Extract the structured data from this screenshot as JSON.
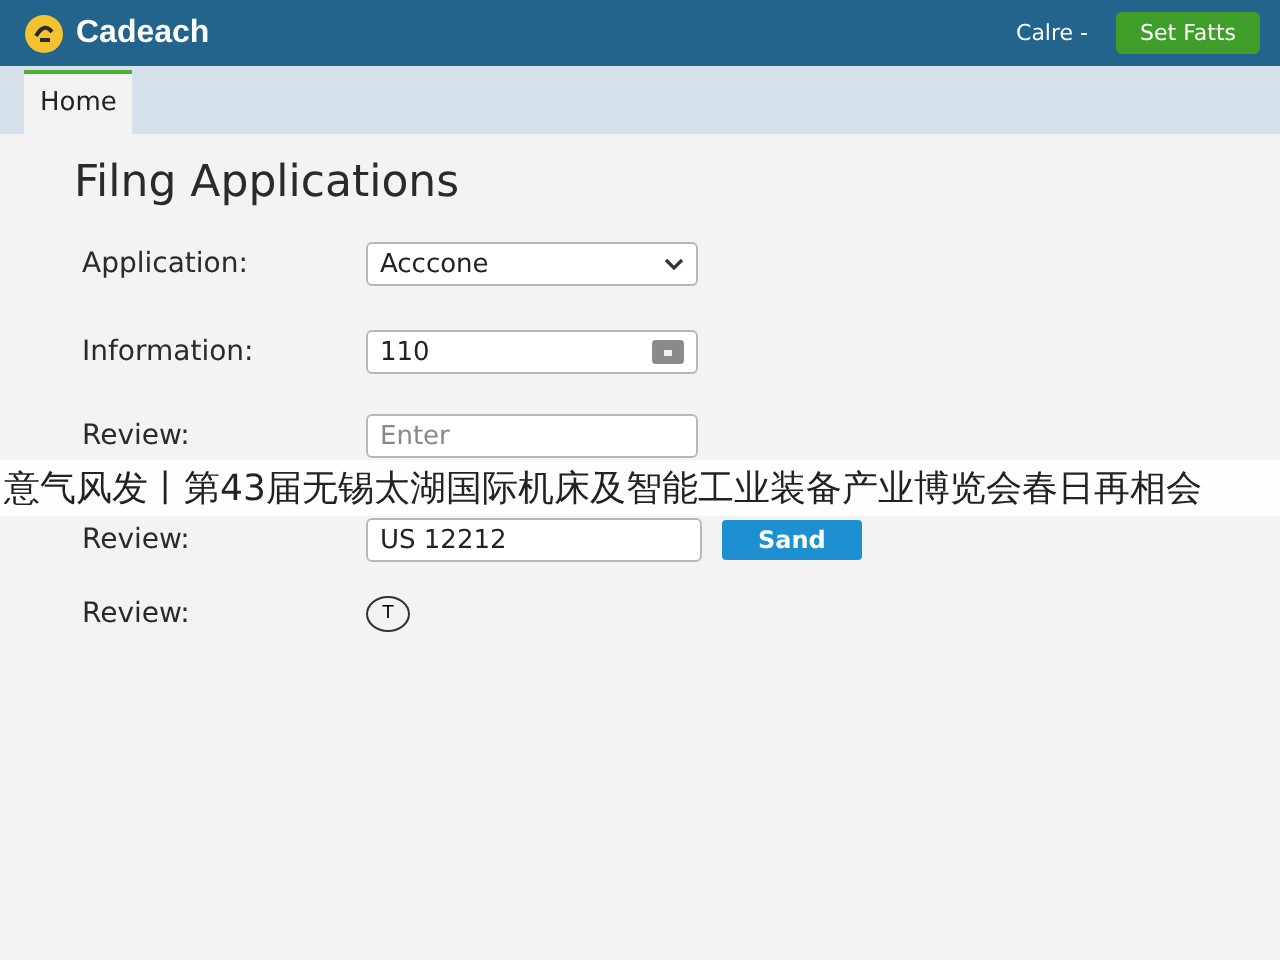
{
  "app": {
    "name": "Cadeach",
    "user_menu": "Calre -",
    "action_button": "Set Fatts"
  },
  "tabs": [
    {
      "label": "Home",
      "selected": true
    }
  ],
  "page_title": "Filng Applications",
  "fields": [
    {
      "kind": "select",
      "label": "Application:",
      "value": "Acccone"
    },
    {
      "kind": "input-icon",
      "label": "Information:",
      "value": "110"
    },
    {
      "kind": "input",
      "label": "Review:",
      "placeholder": "Enter"
    },
    {
      "kind": "input-button",
      "label": "Review:",
      "value": "US 12212",
      "button": "Sand"
    },
    {
      "kind": "badge",
      "label": "Review:",
      "value": "T"
    }
  ],
  "overlay_banner": "意气风发丨第43届无锡太湖国际机床及智能工业装备产业博览会春日再相会"
}
